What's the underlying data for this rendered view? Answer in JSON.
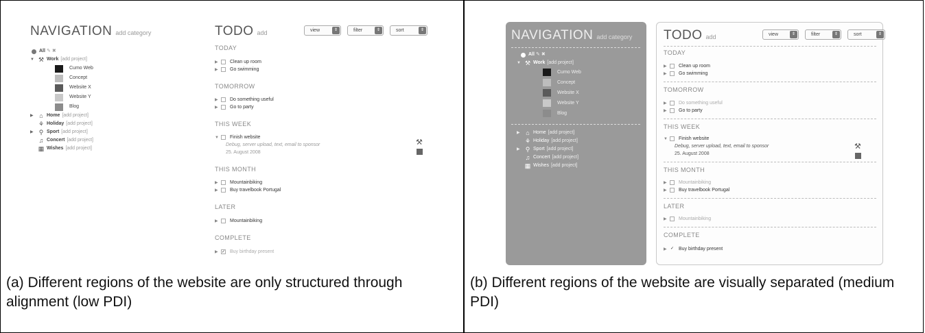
{
  "panel_a": {
    "caption": "(a)  Different regions of the website are only structured through alignment (low PDI)"
  },
  "panel_b": {
    "caption": "(b)  Different regions of the website are visually separated (medium PDI)"
  },
  "navigation": {
    "title": "NAVIGATION",
    "add_label": "add category",
    "all_label": "All",
    "categories": [
      {
        "name": "Work",
        "add": "[add project]",
        "icon": "tools-icon",
        "expanded": true
      },
      {
        "name": "Home",
        "add": "[add project]",
        "icon": "house-icon",
        "expanded": false
      },
      {
        "name": "Holiday",
        "add": "[add project]",
        "icon": "palm-icon",
        "expanded": false
      },
      {
        "name": "Sport",
        "add": "[add project]",
        "icon": "bicycle-icon",
        "expanded": false
      },
      {
        "name": "Concert",
        "add": "[add project]",
        "icon": "headphones-icon",
        "expanded": false
      },
      {
        "name": "Wishes",
        "add": "[add project]",
        "icon": "gift-icon",
        "expanded": false
      }
    ],
    "projects": [
      {
        "name": "Cumo Web",
        "color": "#1a1a1a"
      },
      {
        "name": "Concept",
        "color": "#bdbdbd"
      },
      {
        "name": "Website X",
        "color": "#5a5a5a"
      },
      {
        "name": "Website Y",
        "color": "#c9c9c9"
      },
      {
        "name": "Blog",
        "color": "#8c8c8c"
      }
    ]
  },
  "todo": {
    "title": "TODO",
    "add_label": "add",
    "selects": {
      "view": "view",
      "filter": "filter",
      "sort": "sort"
    },
    "sections": {
      "today": {
        "label": "TODAY",
        "tasks": [
          "Clean up room",
          "Go swimming"
        ]
      },
      "tomorrow": {
        "label": "TOMORROW",
        "tasks": [
          "Do something useful",
          "Go to party"
        ]
      },
      "this_week": {
        "label": "THIS WEEK",
        "task": "Finish website",
        "detail": "Debug, server upload, text, email to sponsor",
        "date": "25. August 2008"
      },
      "this_month": {
        "label": "THIS MONTH",
        "tasks": [
          "Mountainbiking",
          "Buy travelbook Portugal"
        ]
      },
      "later": {
        "label": "LATER",
        "tasks": [
          "Mountainbiking"
        ]
      },
      "complete": {
        "label": "COMPLETE",
        "tasks": [
          "Buy birthday present"
        ]
      }
    }
  }
}
